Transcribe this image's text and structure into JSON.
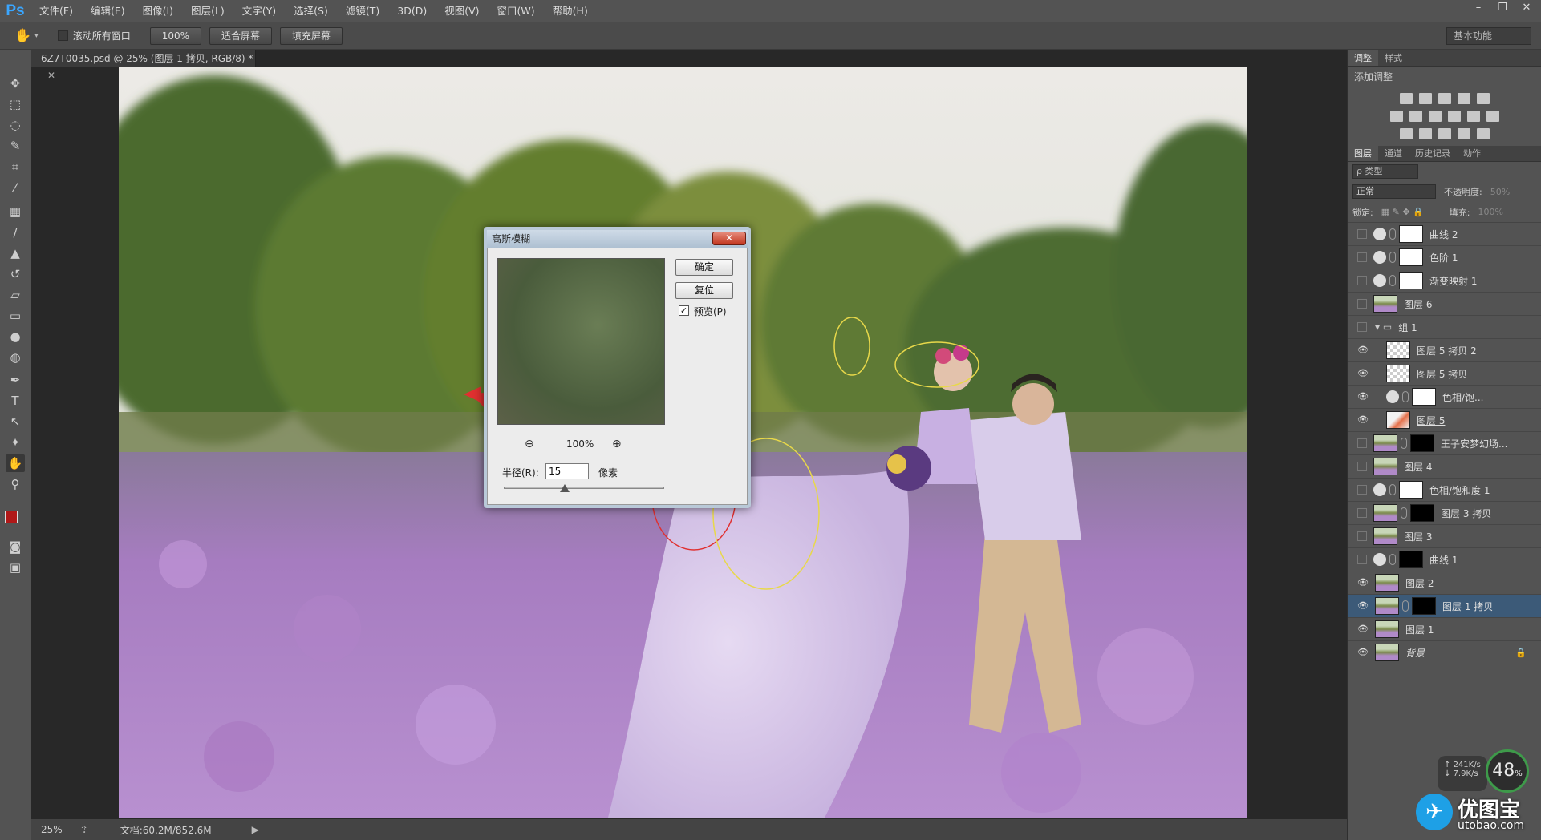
{
  "app": {
    "logo": "Ps"
  },
  "menu": [
    "文件(F)",
    "编辑(E)",
    "图像(I)",
    "图层(L)",
    "文字(Y)",
    "选择(S)",
    "滤镜(T)",
    "3D(D)",
    "视图(V)",
    "窗口(W)",
    "帮助(H)"
  ],
  "options": {
    "scroll_all_label": "滚动所有窗口",
    "zoom_value": "100%",
    "fit_screen": "适合屏幕",
    "fill_screen": "填充屏幕",
    "workspace": "基本功能"
  },
  "document": {
    "tab_title": "6Z7T0035.psd @ 25% (图层 1 拷贝, RGB/8) *",
    "zoom": "25%",
    "doc_size": "文档:60.2M/852.6M"
  },
  "dialog": {
    "title": "高斯模糊",
    "ok": "确定",
    "reset": "复位",
    "preview_label": "预览(P)",
    "preview_checked": true,
    "zoom": "100%",
    "radius_label": "半径(R):",
    "radius_value": "15",
    "unit": "像素",
    "slider_fraction": 0.38
  },
  "panels": {
    "adjust_tabs": [
      "调整",
      "样式"
    ],
    "add_adjust": "添加调整",
    "layer_tabs": [
      "图层",
      "通道",
      "历史记录",
      "动作"
    ],
    "kind_filter": "ρ 类型",
    "blend_mode": "正常",
    "opacity_label": "不透明度:",
    "opacity_value": "50%",
    "lock_label": "锁定:",
    "fill_label": "填充:",
    "fill_value": "100%",
    "layers": [
      {
        "name": "曲线 2",
        "visible": false,
        "type": "adjust",
        "mask": "white"
      },
      {
        "name": "色阶 1",
        "visible": false,
        "type": "adjust",
        "mask": "white"
      },
      {
        "name": "渐变映射 1",
        "visible": false,
        "type": "adjust",
        "mask": "white"
      },
      {
        "name": "图层 6",
        "visible": false,
        "type": "photo"
      },
      {
        "name": "组 1",
        "visible": false,
        "type": "group"
      },
      {
        "name": "图层 5 拷贝 2",
        "visible": true,
        "type": "transparent",
        "indent": true
      },
      {
        "name": "图层 5 拷贝",
        "visible": true,
        "type": "transparent",
        "indent": true
      },
      {
        "name": "色相/饱...",
        "visible": true,
        "type": "adjust",
        "mask": "white",
        "indent": true
      },
      {
        "name": "图层 5",
        "visible": true,
        "type": "photo-red",
        "indent": true
      },
      {
        "name": "王子安梦幻场...",
        "visible": false,
        "type": "photo",
        "mask": "black"
      },
      {
        "name": "图层 4",
        "visible": false,
        "type": "photo"
      },
      {
        "name": "色相/饱和度 1",
        "visible": false,
        "type": "adjust",
        "mask": "white"
      },
      {
        "name": "图层 3 拷贝",
        "visible": false,
        "type": "photo",
        "mask": "black"
      },
      {
        "name": "图层 3",
        "visible": false,
        "type": "photo"
      },
      {
        "name": "曲线 1",
        "visible": false,
        "type": "adjust",
        "mask": "black"
      },
      {
        "name": "图层 2",
        "visible": true,
        "type": "photo"
      },
      {
        "name": "图层 1 拷贝",
        "visible": true,
        "type": "photo",
        "mask": "black",
        "selected": true
      },
      {
        "name": "图层 1",
        "visible": true,
        "type": "photo"
      },
      {
        "name": "背景",
        "visible": true,
        "type": "photo",
        "locked": true
      }
    ],
    "net_up": "241K/s",
    "net_down": "7.9K/s",
    "cpu": "48",
    "cpu_unit": "%"
  },
  "watermark": {
    "cn": "优图宝",
    "url": "utobao.com"
  },
  "colors": {
    "accent": "#3aa6ff",
    "selection": "#3c5a78",
    "annotation_red": "#e03030",
    "annotation_yellow": "#e8d84a"
  }
}
